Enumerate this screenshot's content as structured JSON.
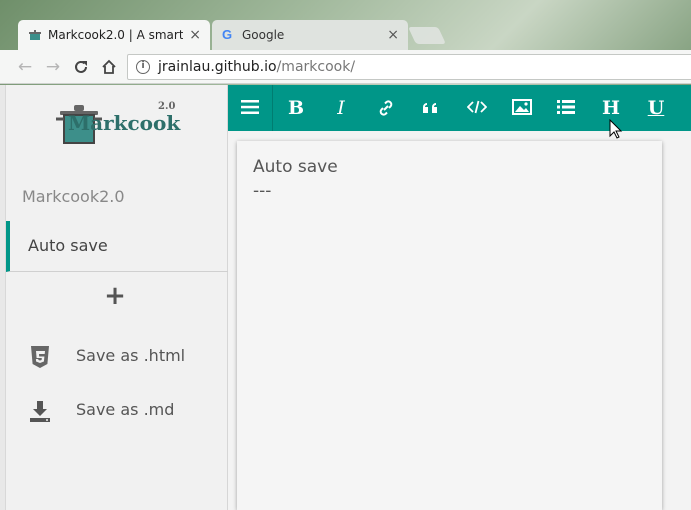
{
  "browser": {
    "tabs": [
      {
        "title": "Markcook2.0 | A smart",
        "close": "×",
        "active": true
      },
      {
        "title": "Google",
        "close": "×",
        "active": false
      }
    ],
    "url_host": "jrainlau.github.io",
    "url_path": "/markcook/",
    "nav": {
      "back": "←",
      "forward": "→",
      "reload": "C",
      "home": "⌂",
      "info": "i"
    }
  },
  "sidebar": {
    "logo_text": "Markcook",
    "logo_version": "2.0",
    "brand": "Markcook2.0",
    "documents": [
      {
        "label": "Auto save"
      }
    ],
    "add_label": "+",
    "actions": [
      {
        "label": "Save as .html",
        "icon": "html5-icon"
      },
      {
        "label": "Save as .md",
        "icon": "download-icon"
      }
    ]
  },
  "toolbar": {
    "menu": "≡",
    "bold": "B",
    "italic": "I",
    "heading": "H",
    "underline": "U"
  },
  "editor": {
    "line1": "Auto save",
    "line2": "---"
  },
  "colors": {
    "accent": "#009688"
  }
}
